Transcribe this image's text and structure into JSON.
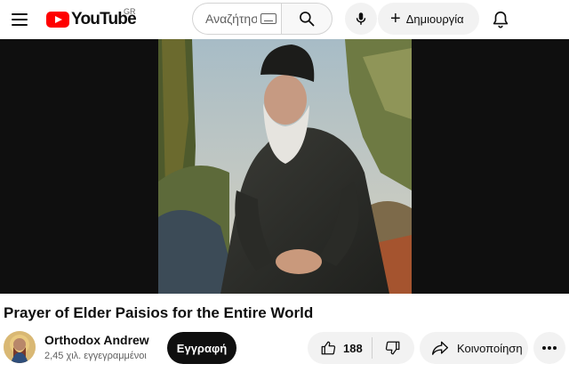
{
  "header": {
    "logo_text": "YouTube",
    "region_code": "GR",
    "search_placeholder": "Αναζήτηση",
    "create_label": "Δημιουργία",
    "icons": [
      "menu-icon",
      "search-icon",
      "keyboard-icon",
      "mic-icon",
      "plus-icon",
      "bell-icon"
    ]
  },
  "video": {
    "title": "Prayer of Elder Paisios for the Entire World"
  },
  "channel": {
    "name": "Orthodox Andrew",
    "subscribers": "2,45 χιλ. εγγεγραμμένοι",
    "subscribe_label": "Εγγραφή"
  },
  "actions": {
    "like_count": "188",
    "share_label": "Κοινοποίηση",
    "icons": [
      "thumbs-up-icon",
      "thumbs-down-icon",
      "share-icon",
      "more-icon"
    ]
  },
  "colors": {
    "brand_red": "#ff0000",
    "text": "#0f0f0f",
    "secondary_text": "#606060",
    "chip_bg": "#f2f2f2",
    "player_bg": "#0f0f0f"
  }
}
